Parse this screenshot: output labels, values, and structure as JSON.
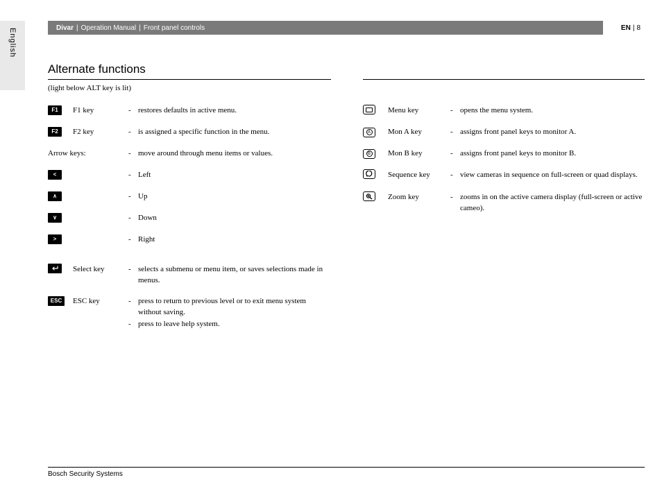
{
  "sidebar": {
    "language": "English"
  },
  "header": {
    "product": "Divar",
    "doc": "Operation Manual",
    "section": "Front panel controls",
    "lang": "EN",
    "page": "8"
  },
  "title": "Alternate functions",
  "subnote": "(light below ALT key is lit)",
  "left": {
    "f1": {
      "icon": "F1",
      "name": "F1 key",
      "desc": "restores defaults in active menu."
    },
    "f2": {
      "icon": "F2",
      "name": "F2 key",
      "desc": "is assigned a specific function in the menu."
    },
    "arrows_label": "Arrow keys:",
    "arrows_desc": "move around through menu items or values.",
    "left_arrow": {
      "sym": "<",
      "desc": "Left"
    },
    "up_arrow": {
      "sym": "∧",
      "desc": "Up"
    },
    "down_arrow": {
      "sym": "∨",
      "desc": "Down"
    },
    "right_arrow": {
      "sym": ">",
      "desc": "Right"
    },
    "select": {
      "name": "Select key",
      "desc": "selects a submenu or menu item, or saves selections made in menus."
    },
    "esc": {
      "icon": "ESC",
      "name": "ESC key",
      "desc1": "press to return to previous level or to exit menu system without saving.",
      "desc2": "press to leave help system."
    }
  },
  "right": {
    "menu": {
      "name": "Menu key",
      "desc": "opens the menu system."
    },
    "mona": {
      "letter": "A",
      "name": "Mon A key",
      "desc": "assigns front panel keys to monitor A."
    },
    "monb": {
      "letter": "B",
      "name": "Mon B key",
      "desc": "assigns front panel keys to monitor B."
    },
    "seq": {
      "name": "Sequence key",
      "desc": "view cameras in sequence on full-screen or quad displays."
    },
    "zoom": {
      "name": "Zoom key",
      "desc": "zooms in on the active camera display (full-screen or active cameo)."
    }
  },
  "footer": "Bosch Security Systems",
  "dash": "-",
  "sep": "|"
}
